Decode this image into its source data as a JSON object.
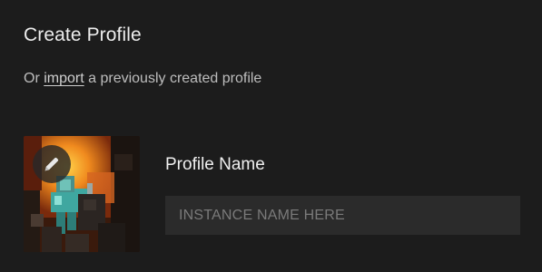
{
  "dialog": {
    "title": "Create Profile",
    "subtitle_prefix": "Or ",
    "import_link": "import",
    "subtitle_suffix": " a previously created profile"
  },
  "profile": {
    "image_icon": "profile-artwork",
    "edit_icon": "pencil-icon",
    "name_label": "Profile Name",
    "name_value": "",
    "name_placeholder": "INSTANCE NAME HERE"
  },
  "colors": {
    "background": "#1c1c1c",
    "input_background": "#2b2b2b",
    "text": "#ececec",
    "muted_text": "#bdbdbd",
    "placeholder": "#7a7a7a"
  }
}
